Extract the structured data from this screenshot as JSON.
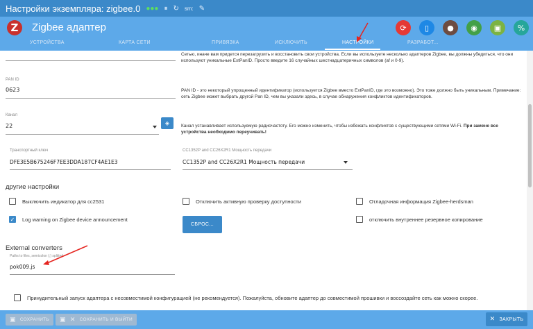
{
  "titlebar": {
    "title": "Настройки экземпляра: zigbee.0",
    "status_icons": [
      "live",
      "sync",
      "refresh"
    ],
    "unit_label": "sm:",
    "edit_icon": "pencil-icon"
  },
  "app": {
    "title": "Zigbee адаптер",
    "logo_letter": "Z",
    "action_colors": [
      "#e53935",
      "#1e88e5",
      "#6d4c41",
      "#43a047",
      "#7cb342",
      "#26a69a"
    ]
  },
  "tabs": [
    {
      "label": "Устройства",
      "active": false
    },
    {
      "label": "Карта сети",
      "active": false
    },
    {
      "label": "Привязка",
      "active": false
    },
    {
      "label": "Исключить",
      "active": false
    },
    {
      "label": "Настройки",
      "active": true
    },
    {
      "label": "Разработ...",
      "active": false
    }
  ],
  "extpanid_help": "Сетью, иначе вам придется перезагрузить и восстановить свои устройства. Если вы используете несколько адаптеров Zigbee, вы должны убедиться, что они используют уникальные ExtPanID. Просто введите 16 случайных шестнадцатеричных символов (af и 0-9).",
  "panid": {
    "label": "PAN ID",
    "value": "0623",
    "help": "PAN ID - это некоторый упрощенный идентификатор (используется Zigbee вместо ExtPanID, где это возможно). Это тоже должно быть уникальным. Примечание: сеть Zigbee может выбрать другой Pan ID, чем вы указали здесь, в случае обнаружения конфликтов идентификаторов."
  },
  "channel": {
    "label": "Канал",
    "value": "22",
    "help_plain": "Канал устанавливает используемую радиочастоту. Его можно изменить, чтобы избежать конфликтов с существующими сетями Wi-Fi.",
    "help_bold": "При замене все устройства необходимо переучивать!"
  },
  "transport_key": {
    "label": "Транспортный ключ",
    "value": "DFE3E5B675246F7EE3DDA187CF4AE1E3"
  },
  "power": {
    "label": "CC1352P and CC26X2R1 Мощность передачи",
    "value": "CC1352P and CC26X2R1 Мощность передачи"
  },
  "other": {
    "title": "другие настройки",
    "checkboxes": [
      {
        "label": "Выключить индикатор для cc2531",
        "checked": false
      },
      {
        "label": "Отключить активную проверку доступности",
        "checked": false
      },
      {
        "label": "Отладочная информация Zigbee-herdsman",
        "checked": false
      },
      {
        "label": "Log warning on Zigbee device announcement",
        "checked": true
      },
      {
        "label": "отключить внутреннее резервное копирование",
        "checked": false
      }
    ],
    "reset_label": "СБРОС..."
  },
  "converters": {
    "title": "External converters",
    "label": "Paths to files, semicolon (;) splitted",
    "value": "pok009.js"
  },
  "force": {
    "label": "Принудительный запуск адаптера с несовместимой конфигурацией (не рекомендуется). Пожалуйста, обновите адаптер до совместимой прошивки и воссоздайте сеть как можно скорее.",
    "checked": false
  },
  "bottom": {
    "save_label": "СОХРАНИТЬ",
    "save_close_label": "СОХРАНИТЬ И ВЫЙТИ",
    "close_label": "ЗАКРЫТЬ"
  },
  "colors": {
    "titlebar": "#3b89c9",
    "appbar": "#5da9e9",
    "accent": "#3b89c9",
    "annotation": "#e5241f"
  }
}
